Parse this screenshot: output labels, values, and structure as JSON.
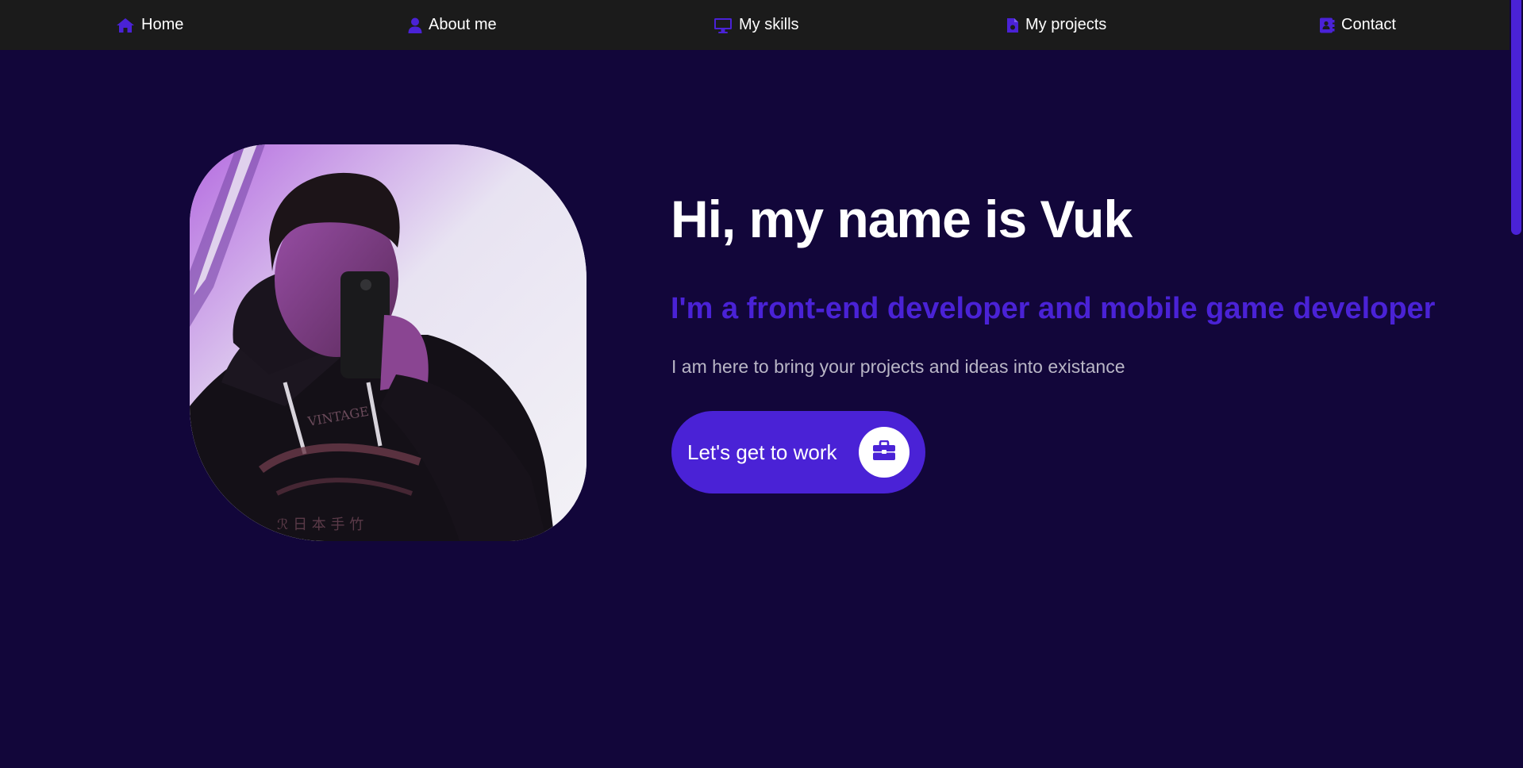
{
  "nav": {
    "items": [
      {
        "label": "Home",
        "icon": "home-icon"
      },
      {
        "label": "About me",
        "icon": "user-icon"
      },
      {
        "label": "My skills",
        "icon": "monitor-icon"
      },
      {
        "label": "My projects",
        "icon": "file-icon"
      },
      {
        "label": "Contact",
        "icon": "contact-book-icon"
      }
    ]
  },
  "hero": {
    "title": "Hi, my name is Vuk",
    "subtitle": "I'm a front-end developer and mobile game developer",
    "tagline": "I am here to bring your projects and ideas into existance",
    "cta_label": "Let's get to work",
    "cta_icon": "briefcase-icon"
  },
  "colors": {
    "background": "#12063a",
    "navbar": "#1b1b1b",
    "accent": "#4a22d6",
    "text": "#ffffff",
    "muted_text": "#b9b6c6"
  }
}
